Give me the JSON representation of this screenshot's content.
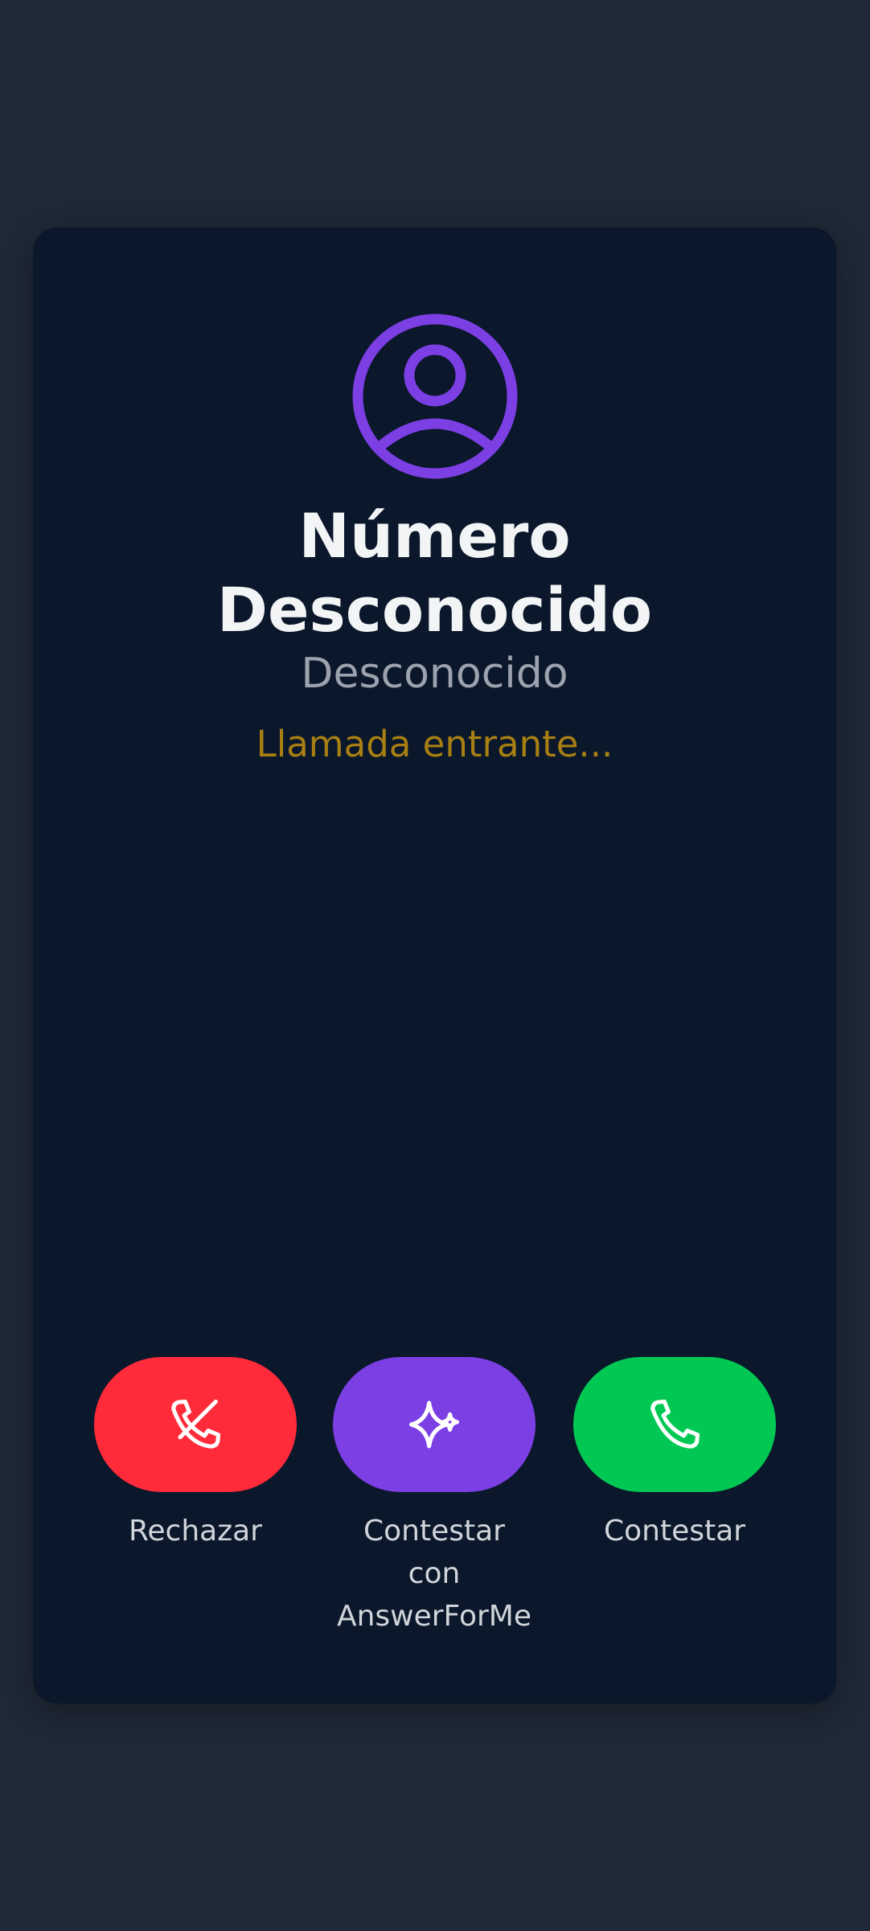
{
  "caller": {
    "name_lines": [
      "Número",
      "Desconocido"
    ],
    "subtitle": "Desconocido",
    "status": "Llamada entrante...",
    "avatar_icon": "user-circle-icon"
  },
  "actions": {
    "reject": {
      "label": "Rechazar",
      "icon": "phone-slash-icon",
      "color": "#ff2a3a"
    },
    "answer_ai": {
      "label_lines": [
        "Contestar",
        "con",
        "AnswerForMe"
      ],
      "icon": "sparkles-icon",
      "color": "#7b3fe4"
    },
    "answer": {
      "label": "Contestar",
      "icon": "phone-icon",
      "color": "#00c853"
    }
  },
  "colors": {
    "background": "#1f2937",
    "card": "#0b172a",
    "accent": "#7b3fe4",
    "status_text": "#a87f12"
  }
}
